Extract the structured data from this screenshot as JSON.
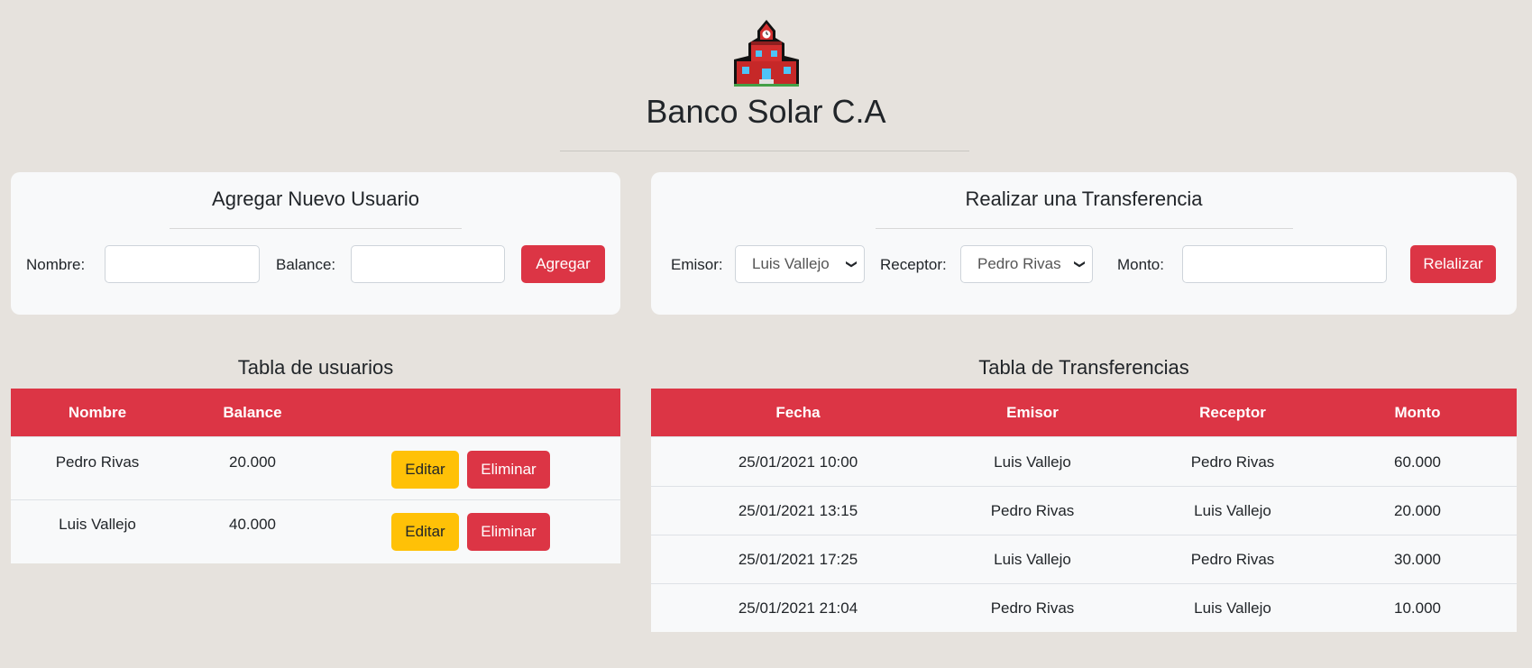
{
  "app": {
    "title": "Banco Solar C.A"
  },
  "new_user": {
    "title": "Agregar Nuevo Usuario",
    "name_label": "Nombre:",
    "name_value": "",
    "balance_label": "Balance:",
    "balance_value": "",
    "add_button": "Agregar"
  },
  "transfer": {
    "title": "Realizar una Transferencia",
    "sender_label": "Emisor:",
    "sender_selected": "Luis Vallejo",
    "receiver_label": "Receptor:",
    "receiver_selected": "Pedro Rivas",
    "amount_label": "Monto:",
    "amount_value": "",
    "submit_button": "Relalizar"
  },
  "users_table": {
    "title": "Tabla de usuarios",
    "headers": [
      "Nombre",
      "Balance",
      ""
    ],
    "edit_label": "Editar",
    "delete_label": "Eliminar",
    "rows": [
      {
        "name": "Pedro Rivas",
        "balance": "20.000"
      },
      {
        "name": "Luis Vallejo",
        "balance": "40.000"
      }
    ]
  },
  "transfers_table": {
    "title": "Tabla de Transferencias",
    "headers": [
      "Fecha",
      "Emisor",
      "Receptor",
      "Monto"
    ],
    "rows": [
      {
        "date": "25/01/2021 10:00",
        "sender": "Luis Vallejo",
        "receiver": "Pedro Rivas",
        "amount": "60.000"
      },
      {
        "date": "25/01/2021 13:15",
        "sender": "Pedro Rivas",
        "receiver": "Luis Vallejo",
        "amount": "20.000"
      },
      {
        "date": "25/01/2021 17:25",
        "sender": "Luis Vallejo",
        "receiver": "Pedro Rivas",
        "amount": "30.000"
      },
      {
        "date": "25/01/2021 21:04",
        "sender": "Pedro Rivas",
        "receiver": "Luis Vallejo",
        "amount": "10.000"
      }
    ]
  },
  "icons": {
    "logo": "school-building-icon",
    "select_arrow": "chevron-down-icon"
  },
  "colors": {
    "accent": "#dc3545",
    "warning": "#ffc107",
    "background": "#e6e2dd",
    "card": "#f8f9fa"
  }
}
